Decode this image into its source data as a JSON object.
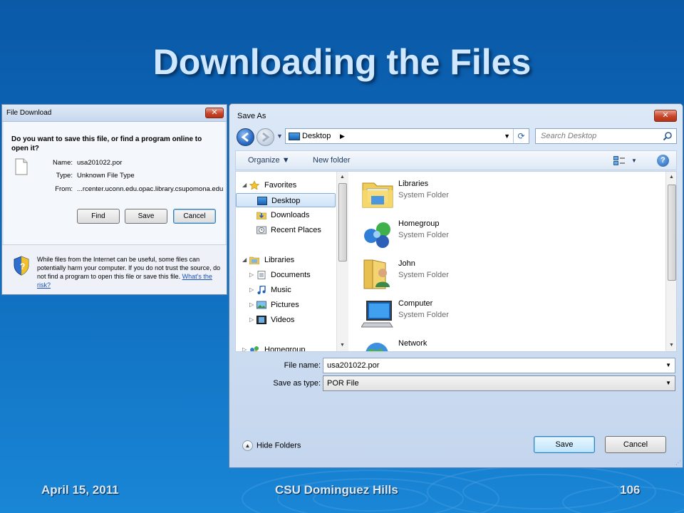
{
  "slide": {
    "title": "Downloading the Files",
    "footer": {
      "date": "April 15, 2011",
      "organization": "CSU Dominguez Hills",
      "page_number": "106"
    }
  },
  "file_download": {
    "title": "File Download",
    "close_glyph": "✕",
    "question": "Do you want to save this file, or find a program online to open it?",
    "name_label": "Name:",
    "name_value": "usa201022.por",
    "type_label": "Type:",
    "type_value": "Unknown File Type",
    "from_label": "From:",
    "from_value": "...rcenter.uconn.edu.opac.library.csupomona.edu",
    "buttons": {
      "find": "Find",
      "save": "Save",
      "cancel": "Cancel"
    },
    "warning": "While files from the Internet can be useful, some files can potentially harm your computer. If you do not trust the source, do not find a program to open this file or save this file.",
    "warning_link": "What's the risk?",
    "icons": [
      "document-icon",
      "shield-icon"
    ]
  },
  "save_as": {
    "title": "Save As",
    "close_glyph": "✕",
    "address": {
      "location": "Desktop",
      "chevron": "▶",
      "dropdown": "▼",
      "refresh": "⟳"
    },
    "search_placeholder": "Search Desktop",
    "toolbar": {
      "organize": "Organize ▼",
      "new_folder": "New folder",
      "view_dropdown": "▼",
      "help": "?"
    },
    "nav": [
      {
        "label": "Favorites",
        "arrow": "◢",
        "icon": "star-icon"
      },
      {
        "label": "Desktop",
        "arrow": "",
        "icon": "desktop-icon",
        "selected": true
      },
      {
        "label": "Downloads",
        "arrow": "",
        "icon": "downloads-folder-icon"
      },
      {
        "label": "Recent Places",
        "arrow": "",
        "icon": "recent-places-icon"
      },
      {
        "label": "Libraries",
        "arrow": "◢",
        "icon": "libraries-icon"
      },
      {
        "label": "Documents",
        "arrow": "▷",
        "icon": "documents-icon"
      },
      {
        "label": "Music",
        "arrow": "▷",
        "icon": "music-icon"
      },
      {
        "label": "Pictures",
        "arrow": "▷",
        "icon": "pictures-icon"
      },
      {
        "label": "Videos",
        "arrow": "▷",
        "icon": "videos-icon"
      },
      {
        "label": "Homegroup",
        "arrow": "▷",
        "icon": "homegroup-icon"
      }
    ],
    "items": [
      {
        "name": "Libraries",
        "type": "System Folder",
        "icon": "libraries-folder-icon"
      },
      {
        "name": "Homegroup",
        "type": "System Folder",
        "icon": "homegroup-icon"
      },
      {
        "name": "John",
        "type": "System Folder",
        "icon": "user-folder-icon"
      },
      {
        "name": "Computer",
        "type": "System Folder",
        "icon": "computer-icon"
      },
      {
        "name": "Network",
        "type": "",
        "icon": "network-icon"
      }
    ],
    "file_name_label": "File name:",
    "file_name_value": "usa201022.por",
    "save_type_label": "Save as type:",
    "save_type_value": "POR File",
    "combo_dropdown": "▼",
    "hide_folders": "Hide Folders",
    "hide_folders_glyph": "▲",
    "buttons": {
      "save": "Save",
      "cancel": "Cancel"
    },
    "scroll_up": "▲",
    "scroll_down": "▼",
    "grip": "⋰"
  },
  "colors": {
    "slide_bg": "#0d67b8",
    "title_text": "#cfe8ff",
    "dialog_bg": "#dce8f6",
    "close_red": "#c8452a",
    "link": "#1a4fb8"
  }
}
